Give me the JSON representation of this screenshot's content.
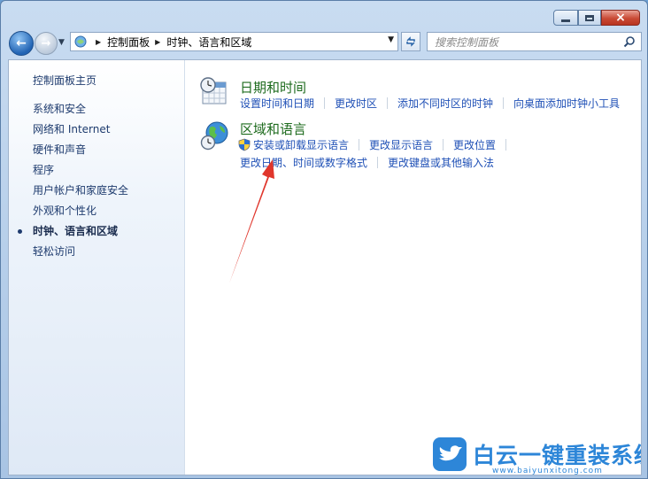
{
  "window": {
    "caption": {
      "minimize": "minimize",
      "maximize": "maximize",
      "close": "×"
    }
  },
  "nav": {
    "back_icon": "arrow-left-icon",
    "forward_icon": "arrow-right-icon"
  },
  "address_bar": {
    "crumbs": [
      "控制面板",
      "时钟、语言和区域"
    ]
  },
  "search": {
    "placeholder": "搜索控制面板"
  },
  "sidebar": {
    "home": "控制面板主页",
    "items": [
      {
        "label": "系统和安全"
      },
      {
        "label": "网络和 Internet"
      },
      {
        "label": "硬件和声音"
      },
      {
        "label": "程序"
      },
      {
        "label": "用户帐户和家庭安全"
      },
      {
        "label": "外观和个性化"
      },
      {
        "label": "时钟、语言和区域",
        "current": true
      },
      {
        "label": "轻松访问"
      }
    ]
  },
  "categories": [
    {
      "title": "日期和时间",
      "icon": "calendar-clock-icon",
      "tasks": [
        "设置时间和日期",
        "更改时区",
        "添加不同时区的时钟",
        "向桌面添加时钟小工具"
      ]
    },
    {
      "title": "区域和语言",
      "icon": "globe-clock-icon",
      "tasks_row1": [
        "安装或卸载显示语言",
        "更改显示语言",
        "更改位置"
      ],
      "tasks_row2": [
        "更改日期、时间或数字格式",
        "更改键盘或其他输入法"
      ]
    }
  ],
  "watermark": {
    "text": "白云一键重装系统",
    "url": "www.baiyunxitong.com"
  },
  "colors": {
    "link": "#1f50b6",
    "category_title": "#1e6b1e",
    "sidebar_text": "#1e3b6e",
    "annotation_arrow": "#e0362c",
    "watermark": "#2d86d8"
  }
}
